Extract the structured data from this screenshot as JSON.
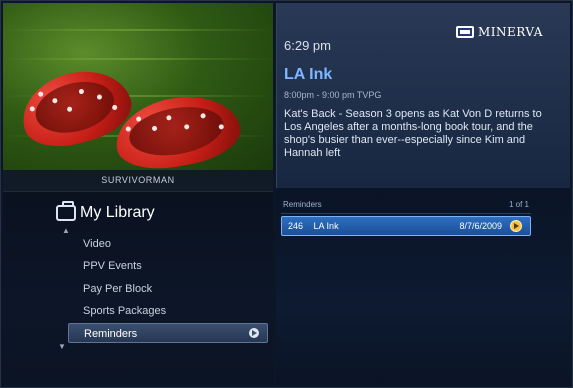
{
  "preview": {
    "credit": "SURVIVORMAN"
  },
  "header": {
    "time": "6:29 pm",
    "brand": "MINERVA"
  },
  "program": {
    "title": "LA Ink",
    "subline": "8:00pm - 9:00 pm  TVPG",
    "description": "Kat's Back - Season 3 opens as Kat Von D returns to Los Angeles after a months-long book tour, and the shop's busier than ever--especially since Kim and Hannah left"
  },
  "library": {
    "title": "My Library",
    "items": [
      {
        "label": "Video"
      },
      {
        "label": "PPV Events"
      },
      {
        "label": "Pay Per Block"
      },
      {
        "label": "Sports Packages"
      },
      {
        "label": "Reminders"
      }
    ]
  },
  "reminders": {
    "header_label": "Reminders",
    "header_count": "1 of 1",
    "rows": [
      {
        "channel": "246",
        "name": "LA Ink",
        "date": "8/7/6/2009"
      }
    ]
  }
}
